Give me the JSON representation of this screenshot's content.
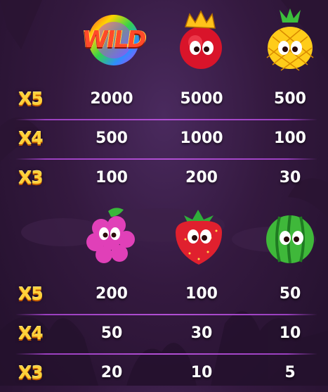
{
  "colors": {
    "background": "#34193f",
    "multiplier": "#ffd23a",
    "value": "#ffffff",
    "divider": "#b24fd4"
  },
  "tables": [
    {
      "symbols": [
        {
          "icon": "wild-icon",
          "text": "WILD"
        },
        {
          "icon": "crowned-cherry-icon",
          "text": ""
        },
        {
          "icon": "pineapple-icon",
          "text": ""
        }
      ],
      "rows": [
        {
          "multiplier": "X5",
          "values": [
            "2000",
            "5000",
            "500"
          ]
        },
        {
          "multiplier": "X4",
          "values": [
            "500",
            "1000",
            "100"
          ]
        },
        {
          "multiplier": "X3",
          "values": [
            "100",
            "200",
            "30"
          ]
        }
      ]
    },
    {
      "symbols": [
        {
          "icon": "grapes-icon",
          "text": ""
        },
        {
          "icon": "strawberry-icon",
          "text": ""
        },
        {
          "icon": "watermelon-icon",
          "text": ""
        }
      ],
      "rows": [
        {
          "multiplier": "X5",
          "values": [
            "200",
            "100",
            "50"
          ]
        },
        {
          "multiplier": "X4",
          "values": [
            "50",
            "30",
            "10"
          ]
        },
        {
          "multiplier": "X3",
          "values": [
            "20",
            "10",
            "5"
          ]
        }
      ]
    }
  ]
}
